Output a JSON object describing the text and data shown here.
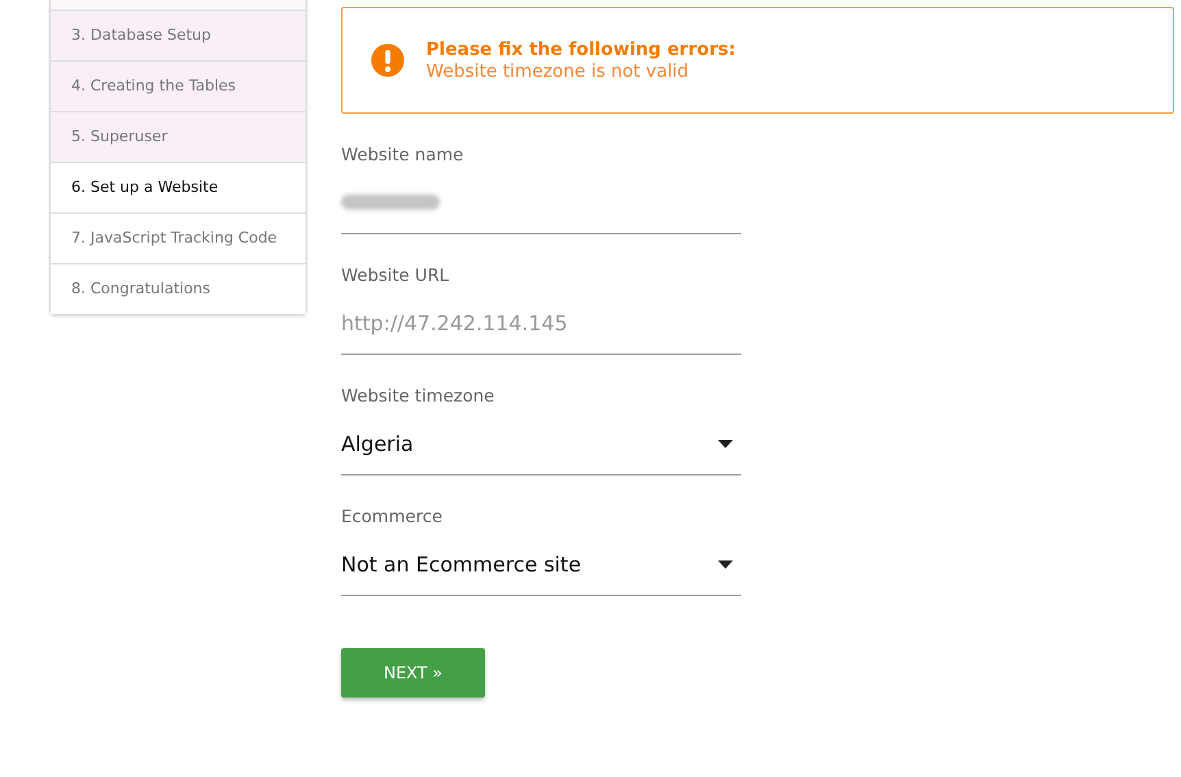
{
  "steps": [
    {
      "label": "3. Database Setup",
      "done": true,
      "selected": false
    },
    {
      "label": "4. Creating the Tables",
      "done": true,
      "selected": false
    },
    {
      "label": "5. Superuser",
      "done": true,
      "selected": false
    },
    {
      "label": "6. Set up a Website",
      "done": false,
      "selected": true
    },
    {
      "label": "7. JavaScript Tracking Code",
      "done": false,
      "selected": false
    },
    {
      "label": "8. Congratulations",
      "done": false,
      "selected": false
    }
  ],
  "alert": {
    "title": "Please fix the following errors:",
    "message": "Website timezone is not valid"
  },
  "fields": [
    {
      "kind": "text",
      "label": "Website name",
      "redacted": true
    },
    {
      "kind": "text",
      "label": "Website URL",
      "placeholder": "http://47.242.114.145"
    },
    {
      "kind": "select",
      "label": "Website timezone",
      "value": "Algeria"
    },
    {
      "kind": "select",
      "label": "Ecommerce",
      "value": "Not an Ecommerce site"
    }
  ],
  "next_button": "NEXT »"
}
